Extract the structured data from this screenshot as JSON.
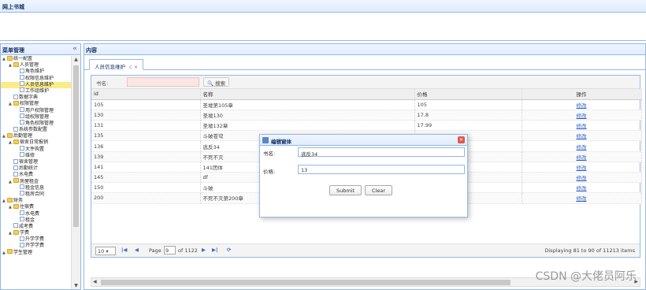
{
  "app": {
    "title": "网上书城"
  },
  "left": {
    "title": "菜单管理",
    "collapse": "«",
    "tree": [
      {
        "label": "统一配置",
        "indent": 0,
        "kind": "folder",
        "toggle": "▲"
      },
      {
        "label": "人员管理",
        "indent": 1,
        "kind": "folder",
        "toggle": "▲"
      },
      {
        "label": "角色维护",
        "indent": 2,
        "kind": "file"
      },
      {
        "label": "权限信息维护",
        "indent": 2,
        "kind": "file"
      },
      {
        "label": "人员信息维护",
        "indent": 2,
        "kind": "file",
        "selected": true
      },
      {
        "label": "工作组维护",
        "indent": 2,
        "kind": "file"
      },
      {
        "label": "数据字典",
        "indent": 1,
        "kind": "file"
      },
      {
        "label": "权限管理",
        "indent": 1,
        "kind": "folder",
        "toggle": "▲"
      },
      {
        "label": "用户权限管理",
        "indent": 2,
        "kind": "file"
      },
      {
        "label": "组权限管理",
        "indent": 2,
        "kind": "file"
      },
      {
        "label": "角色权限管理",
        "indent": 2,
        "kind": "file"
      },
      {
        "label": "系统参数配置",
        "indent": 1,
        "kind": "file"
      },
      {
        "label": "后勤管理",
        "indent": 0,
        "kind": "folder",
        "toggle": "▲"
      },
      {
        "label": "宿舍日常报销",
        "indent": 1,
        "kind": "folder",
        "toggle": "▲"
      },
      {
        "label": "大件购置",
        "indent": 2,
        "kind": "file"
      },
      {
        "label": "维修",
        "indent": 2,
        "kind": "file"
      },
      {
        "label": "宿舍管理",
        "indent": 1,
        "kind": "file"
      },
      {
        "label": "后勤统计",
        "indent": 1,
        "kind": "file"
      },
      {
        "label": "水电费",
        "indent": 1,
        "kind": "file"
      },
      {
        "label": "房屋租金",
        "indent": 1,
        "kind": "folder",
        "toggle": "▲"
      },
      {
        "label": "租金信息",
        "indent": 2,
        "kind": "file"
      },
      {
        "label": "租房合同",
        "indent": 2,
        "kind": "file"
      },
      {
        "label": "财务",
        "indent": 0,
        "kind": "folder",
        "toggle": "▲"
      },
      {
        "label": "住宿费",
        "indent": 1,
        "kind": "folder",
        "toggle": "▲"
      },
      {
        "label": "水电费",
        "indent": 2,
        "kind": "file"
      },
      {
        "label": "租金",
        "indent": 2,
        "kind": "file"
      },
      {
        "label": "成考费",
        "indent": 1,
        "kind": "file"
      },
      {
        "label": "学费",
        "indent": 1,
        "kind": "folder",
        "toggle": "▲"
      },
      {
        "label": "升学学费",
        "indent": 2,
        "kind": "file"
      },
      {
        "label": "开学学费",
        "indent": 2,
        "kind": "file"
      },
      {
        "label": "学生管理",
        "indent": 0,
        "kind": "folder",
        "toggle": "▲"
      }
    ]
  },
  "main": {
    "title": "内容",
    "tab": {
      "label": "人员信息维护",
      "close": "c ×"
    },
    "toolbar": {
      "label": "书名:",
      "search_value": "",
      "search_button": "搜索"
    },
    "columns": [
      "id",
      "名称",
      "价格",
      "操作"
    ],
    "rows": [
      [
        "105",
        "圣墟第105章",
        "105",
        "修改"
      ],
      [
        "130",
        "圣墟130",
        "17.8",
        "修改"
      ],
      [
        "131",
        "圣墟132章",
        "17.99",
        "修改"
      ],
      [
        "135",
        "斗破苍穹",
        "",
        "修改"
      ],
      [
        "136",
        "逃反34",
        "",
        "修改"
      ],
      [
        "139",
        "不死不灭",
        "",
        "修改"
      ],
      [
        "141",
        "141团体",
        "",
        "修改"
      ],
      [
        "145",
        "df",
        "",
        "修改"
      ],
      [
        "150",
        "斗破",
        "",
        "修改"
      ],
      [
        "200",
        "不死不灭第200章",
        "",
        "修改"
      ]
    ],
    "pager": {
      "page_size": "10 ▾",
      "first": "|◀",
      "prev": "◀",
      "page_label": "Page",
      "page_value": "9",
      "of_label": "of 1122",
      "next": "▶",
      "last": "▶|",
      "refresh": "⟳",
      "display": "Displaying 81 to 90 of 11213 items"
    }
  },
  "dialog": {
    "title": "编辑窗体",
    "close": "✕",
    "name_label": "书名:",
    "name_value": "逃反34",
    "price_label": "价格:",
    "price_value": "13",
    "submit": "Submit",
    "clear": "Clear"
  },
  "watermark": "CSDN @大佬员阿乐"
}
